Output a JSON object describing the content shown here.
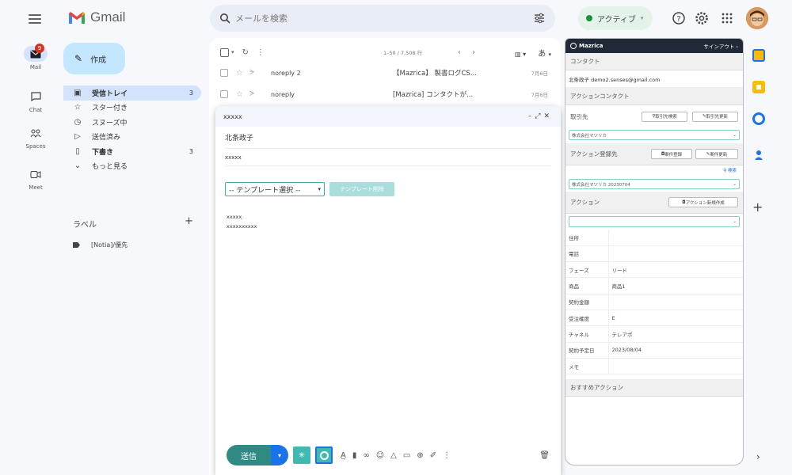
{
  "app": {
    "name": "Gmail"
  },
  "search": {
    "placeholder": "メールを検索"
  },
  "status": {
    "label": "アクティブ"
  },
  "rail": [
    {
      "label": "Mail",
      "badge": "9"
    },
    {
      "label": "Chat"
    },
    {
      "label": "Spaces"
    },
    {
      "label": "Meet"
    }
  ],
  "compose_button": {
    "label": "作成"
  },
  "nav": [
    {
      "label": "受信トレイ",
      "count": "3"
    },
    {
      "label": "スター付き",
      "count": ""
    },
    {
      "label": "スヌーズ中",
      "count": ""
    },
    {
      "label": "送信済み",
      "count": ""
    },
    {
      "label": "下書き",
      "count": "3"
    },
    {
      "label": "もっと見る",
      "count": ""
    }
  ],
  "labels": {
    "heading": "ラベル",
    "items": [
      "[Notia]/優先"
    ]
  },
  "list": {
    "range": "1–50 / 7,508 行",
    "input_lang": "あ",
    "rows": [
      {
        "sender": "noreply 2",
        "subject": "【Mazrica】 製書ログCS...",
        "date": "7月6日"
      },
      {
        "sender": "noreply",
        "subject": "[Mazrica] コンタクトが...",
        "date": "7月6日"
      }
    ]
  },
  "compose_window": {
    "title": "xxxxx",
    "to": "北条政子",
    "subject": "xxxxx",
    "template_select": "-- テンプレート選択 --",
    "template_button": "テンプレート削除",
    "body_line1": "xxxxx",
    "body_line2": "xxxxxxxxxx",
    "send": "送信"
  },
  "panel": {
    "brand": "Mazrica",
    "signout": "サインアウト",
    "contact_heading": "コンタクト",
    "contact_value": "北条政子 demo2.senses@gmail.com",
    "action_contact_heading": "アクションコンタクト",
    "customer_heading": "取引先",
    "btn_customer_search": "取引先検索",
    "btn_customer_update": "取引先更新",
    "customer_value": "株式会社マツリカ",
    "deal_heading": "アクション登録先",
    "btn_deal_register": "案件登録",
    "btn_deal_update": "案件更新",
    "search_link": "検索",
    "deal_value": "株式会社マツリカ 20230704",
    "action_heading": "アクション",
    "btn_action_create": "アクション新規作成",
    "fields": [
      {
        "k": "住所",
        "v": ""
      },
      {
        "k": "電話",
        "v": ""
      },
      {
        "k": "フェーズ",
        "v": "リード"
      },
      {
        "k": "商品",
        "v": "商品1"
      },
      {
        "k": "契約金額",
        "v": ""
      },
      {
        "k": "受注確度",
        "v": "E"
      },
      {
        "k": "チャネル",
        "v": "テレアポ"
      },
      {
        "k": "契約予定日",
        "v": "2023/08/04"
      },
      {
        "k": "メモ",
        "v": ""
      }
    ],
    "recommend_heading": "おすすめアクション"
  },
  "colors": {
    "accent": "#2f8a84",
    "panel_header": "#1f2937",
    "compose_button": "#c2e7ff"
  }
}
